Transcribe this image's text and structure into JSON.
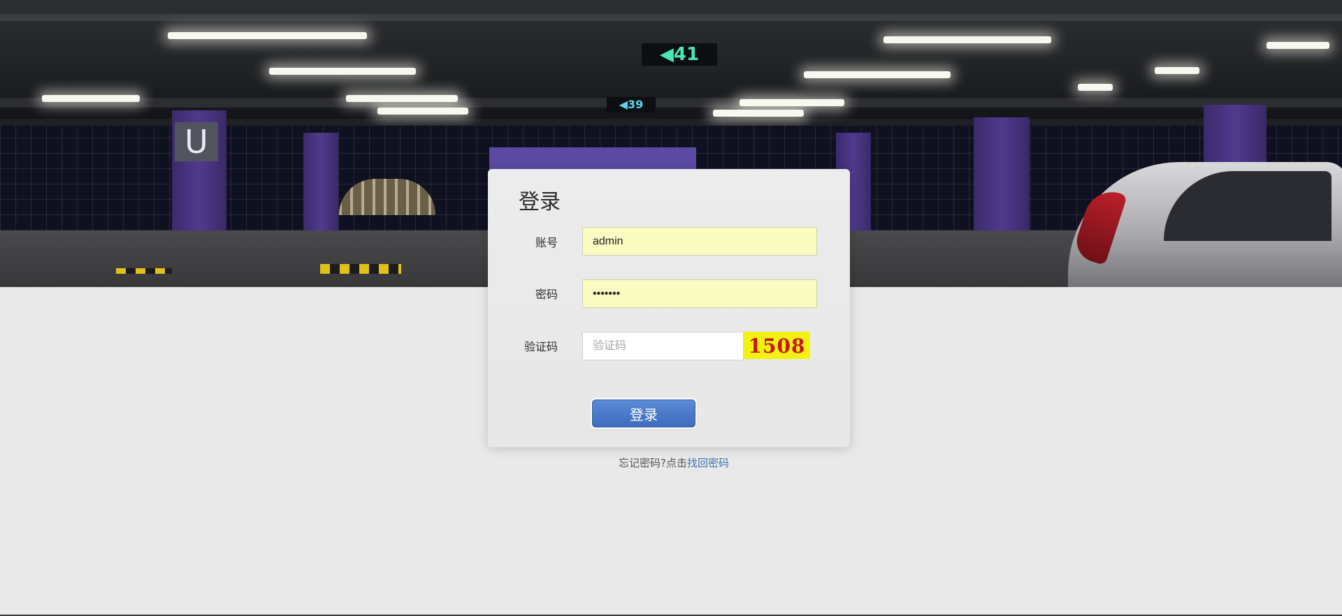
{
  "login": {
    "title": "登录",
    "account_label": "账号",
    "account_value": "admin",
    "password_label": "密码",
    "password_value": "1234567",
    "captcha_label": "验证码",
    "captcha_placeholder": "验证码",
    "captcha_value": "",
    "captcha_code": "1508",
    "submit_label": "登录"
  },
  "forgot": {
    "prefix": "忘记密码?点击",
    "link_text": "找回密码"
  },
  "colors": {
    "page_background": "#e9e9e9",
    "card_background": "#ececec",
    "autofill_background": "#fafcc1",
    "button_blue": "#4a79c9",
    "link_blue": "#3e73b0",
    "captcha_background": "#f3f20e",
    "captcha_text": "#c7161a"
  }
}
